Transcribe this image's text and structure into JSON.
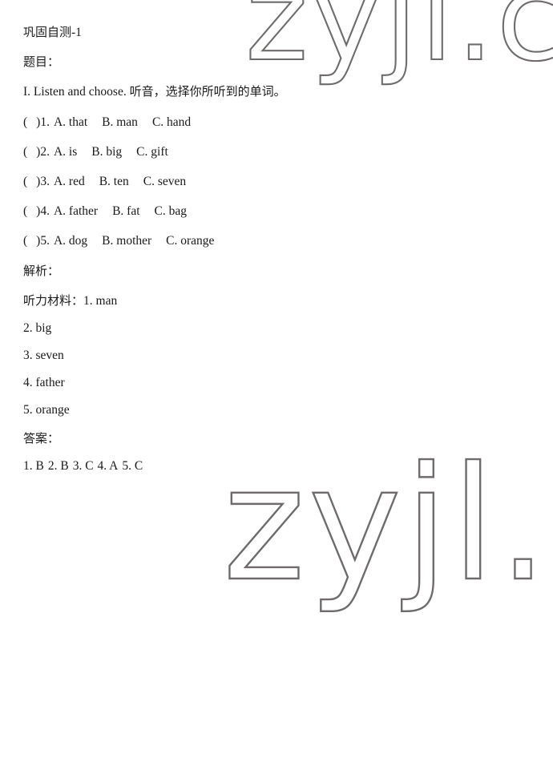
{
  "page": {
    "background_color": "#ffffff",
    "text_color": "#1a1a1a"
  },
  "watermarks": {
    "color": "#6f6b6b",
    "top": "zyji.cn",
    "bottom": "zyjl.cn"
  },
  "document": {
    "title": "巩固自测-1",
    "title_cn": "巩固自测",
    "title_suffix": "-1",
    "sections": {
      "questions_label": "题目：",
      "analysis_label": "解析：",
      "answer_label": "答案："
    },
    "instruction": {
      "number": "I.",
      "english": "Listen and choose.",
      "chinese": "听音，选择你所听到的单词。"
    },
    "questions": [
      {
        "bracket_open": "（",
        "bracket_close": "）",
        "number": "1.",
        "options": [
          "A. that",
          "B. man",
          "C. hand"
        ]
      },
      {
        "bracket_open": "（",
        "bracket_close": "）",
        "number": "2.",
        "options": [
          "A. is",
          "B. big",
          "C. gift"
        ]
      },
      {
        "bracket_open": "（",
        "bracket_close": "）",
        "number": "3.",
        "options": [
          "A. red",
          "B. ten",
          "C. seven"
        ]
      },
      {
        "bracket_open": "（",
        "bracket_close": "）",
        "number": "4.",
        "options": [
          "A. father",
          "B. fat",
          "C. bag"
        ]
      },
      {
        "bracket_open": "（",
        "bracket_close": "）",
        "number": "5.",
        "options": [
          "A. dog",
          "B. mother",
          "C. orange"
        ]
      }
    ],
    "listening_material": {
      "label": "听力材料：",
      "first_item": "1. man",
      "items": [
        "2. big",
        "3. seven",
        "4. father",
        "5. orange"
      ]
    },
    "answers": {
      "items": [
        "1. B",
        "2. B",
        "3. C",
        "4. A",
        "5. C"
      ]
    }
  }
}
